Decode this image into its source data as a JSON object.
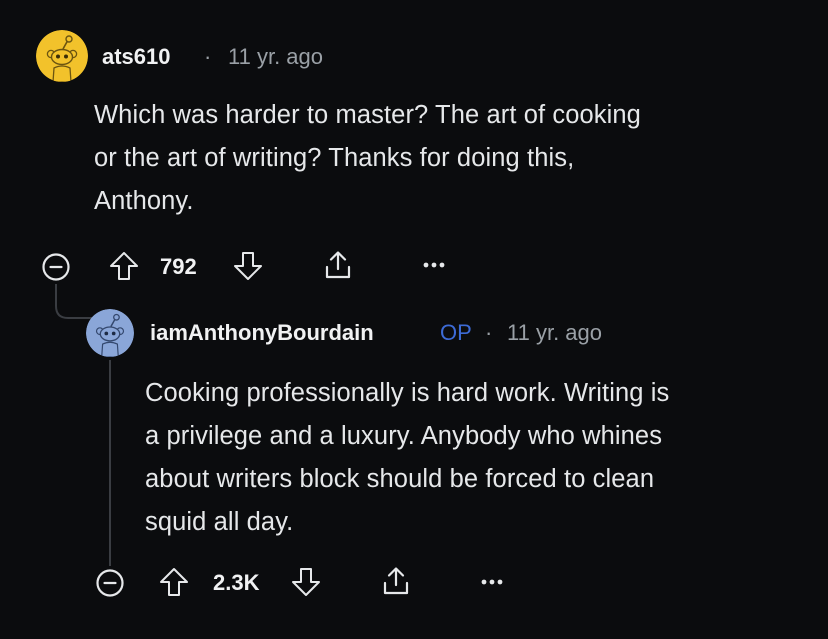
{
  "comments": [
    {
      "username": "ats610",
      "separator": "·",
      "time": "11 yr. ago",
      "body_lines": [
        "Which was harder to master? The art of cooking",
        "or the art of writing? Thanks for doing this,",
        "Anthony."
      ],
      "vote_count": "792",
      "more_label": "···"
    },
    {
      "username": "iamAnthonyBourdain",
      "op_badge": "OP",
      "separator": "·",
      "time": "11 yr. ago",
      "body_lines": [
        "Cooking professionally is hard work. Writing is",
        "a privilege and a luxury. Anybody who whines",
        "about writers block should be forced to clean",
        "squid all day."
      ],
      "vote_count": "2.3K",
      "more_label": "···"
    }
  ],
  "colors": {
    "background": "#0b0c0e",
    "text": "#e6e8ea",
    "meta": "#9aa0a6",
    "op_badge": "#3d6bd6",
    "avatar_yellow": "#f2c22b",
    "avatar_blue": "#8aa6d8"
  },
  "icons": [
    "collapse-icon",
    "upvote-icon",
    "downvote-icon",
    "share-icon",
    "more-icon",
    "snoo-avatar-icon"
  ]
}
